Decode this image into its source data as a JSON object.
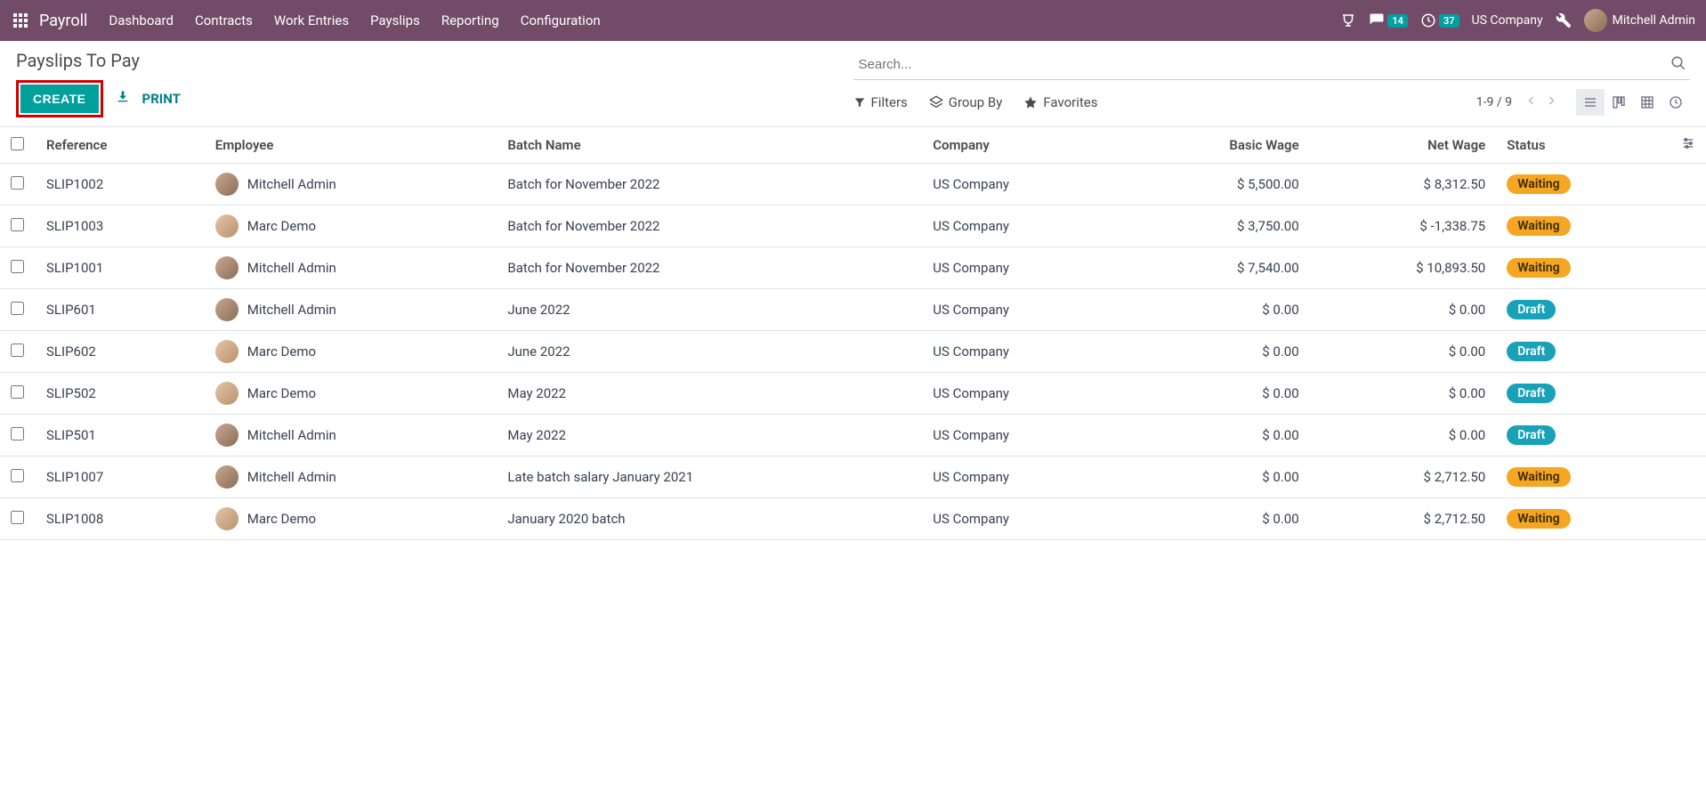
{
  "nav": {
    "brand": "Payroll",
    "items": [
      "Dashboard",
      "Contracts",
      "Work Entries",
      "Payslips",
      "Reporting",
      "Configuration"
    ]
  },
  "systray": {
    "messages_count": "14",
    "activities_count": "37",
    "company": "US Company",
    "user": "Mitchell Admin"
  },
  "page": {
    "title": "Payslips To Pay",
    "create_label": "CREATE",
    "print_label": "PRINT",
    "search_placeholder": "Search...",
    "filters_label": "Filters",
    "groupby_label": "Group By",
    "favorites_label": "Favorites",
    "pager": "1-9 / 9"
  },
  "columns": {
    "reference": "Reference",
    "employee": "Employee",
    "batch": "Batch Name",
    "company": "Company",
    "basic_wage": "Basic Wage",
    "net_wage": "Net Wage",
    "status": "Status"
  },
  "rows": [
    {
      "reference": "SLIP1002",
      "employee": "Mitchell Admin",
      "avatar": "ava-1",
      "batch": "Batch for November 2022",
      "company": "US Company",
      "basic_wage": "$ 5,500.00",
      "net_wage": "$ 8,312.50",
      "status": "Waiting",
      "status_class": "status-waiting"
    },
    {
      "reference": "SLIP1003",
      "employee": "Marc Demo",
      "avatar": "ava-2",
      "batch": "Batch for November 2022",
      "company": "US Company",
      "basic_wage": "$ 3,750.00",
      "net_wage": "$ -1,338.75",
      "status": "Waiting",
      "status_class": "status-waiting"
    },
    {
      "reference": "SLIP1001",
      "employee": "Mitchell Admin",
      "avatar": "ava-1",
      "batch": "Batch for November 2022",
      "company": "US Company",
      "basic_wage": "$ 7,540.00",
      "net_wage": "$ 10,893.50",
      "status": "Waiting",
      "status_class": "status-waiting"
    },
    {
      "reference": "SLIP601",
      "employee": "Mitchell Admin",
      "avatar": "ava-1",
      "batch": "June 2022",
      "company": "US Company",
      "basic_wage": "$ 0.00",
      "net_wage": "$ 0.00",
      "status": "Draft",
      "status_class": "status-draft"
    },
    {
      "reference": "SLIP602",
      "employee": "Marc Demo",
      "avatar": "ava-2",
      "batch": "June 2022",
      "company": "US Company",
      "basic_wage": "$ 0.00",
      "net_wage": "$ 0.00",
      "status": "Draft",
      "status_class": "status-draft"
    },
    {
      "reference": "SLIP502",
      "employee": "Marc Demo",
      "avatar": "ava-2",
      "batch": "May 2022",
      "company": "US Company",
      "basic_wage": "$ 0.00",
      "net_wage": "$ 0.00",
      "status": "Draft",
      "status_class": "status-draft"
    },
    {
      "reference": "SLIP501",
      "employee": "Mitchell Admin",
      "avatar": "ava-1",
      "batch": "May 2022",
      "company": "US Company",
      "basic_wage": "$ 0.00",
      "net_wage": "$ 0.00",
      "status": "Draft",
      "status_class": "status-draft"
    },
    {
      "reference": "SLIP1007",
      "employee": "Mitchell Admin",
      "avatar": "ava-1",
      "batch": "Late batch salary January 2021",
      "company": "US Company",
      "basic_wage": "$ 0.00",
      "net_wage": "$ 2,712.50",
      "status": "Waiting",
      "status_class": "status-waiting"
    },
    {
      "reference": "SLIP1008",
      "employee": "Marc Demo",
      "avatar": "ava-2",
      "batch": "January 2020 batch",
      "company": "US Company",
      "basic_wage": "$ 0.00",
      "net_wage": "$ 2,712.50",
      "status": "Waiting",
      "status_class": "status-waiting"
    }
  ]
}
